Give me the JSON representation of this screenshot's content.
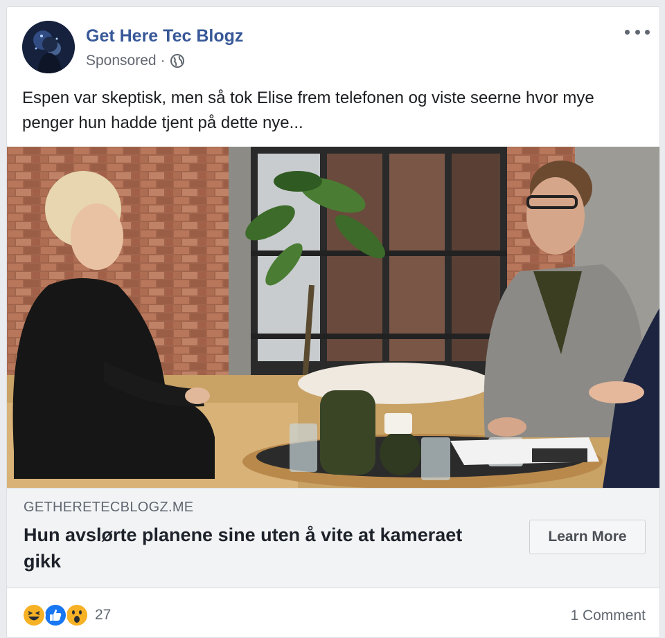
{
  "post": {
    "page_name": "Get Here Tec Blogz",
    "sponsored_label": "Sponsored",
    "separator": "·",
    "body_text": "Espen var skeptisk, men så tok Elise frem telefonen og viste seerne hvor mye penger hun hadde tjent på dette nye..."
  },
  "link_preview": {
    "domain": "GETHERETECBLOGZ.ME",
    "headline": "Hun avslørte planene sine uten å vite at kameraet gikk",
    "cta_label": "Learn More"
  },
  "footer": {
    "reaction_icons": [
      "haha-icon",
      "like-icon",
      "wow-icon"
    ],
    "reaction_count": "27",
    "comment_count_label": "1 Comment"
  },
  "colors": {
    "page_name": "#385898",
    "secondary_text": "#606770",
    "background": "#e9ebee",
    "like_blue": "#1877f2",
    "emoji_yellow": "#f7b125"
  }
}
